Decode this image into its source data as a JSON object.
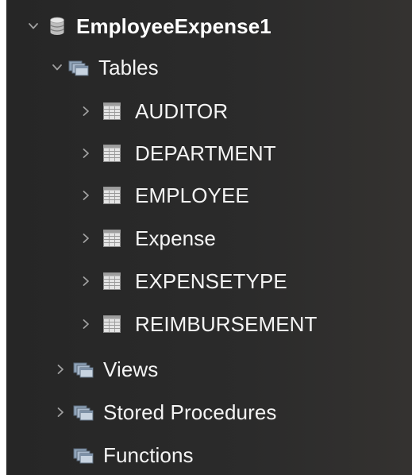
{
  "tree": {
    "database": {
      "label": "EmployeeExpense1",
      "icon": "database-icon",
      "expanded": true
    },
    "folders": [
      {
        "label": "Tables",
        "icon": "folder-icon",
        "expanded": true,
        "children": [
          {
            "label": "AUDITOR",
            "icon": "table-icon"
          },
          {
            "label": "DEPARTMENT",
            "icon": "table-icon"
          },
          {
            "label": "EMPLOYEE",
            "icon": "table-icon"
          },
          {
            "label": "Expense",
            "icon": "table-icon"
          },
          {
            "label": "EXPENSETYPE",
            "icon": "table-icon"
          },
          {
            "label": "REIMBURSEMENT",
            "icon": "table-icon"
          }
        ]
      },
      {
        "label": "Views",
        "icon": "folder-icon",
        "expanded": false
      },
      {
        "label": "Stored Procedures",
        "icon": "folder-icon",
        "expanded": false
      },
      {
        "label": "Functions",
        "icon": "folder-icon",
        "expanded": false,
        "has_children": false
      }
    ]
  },
  "colors": {
    "background": "#2a2a2a",
    "text": "#f4f4f4",
    "chevron": "#a0a0a0"
  }
}
